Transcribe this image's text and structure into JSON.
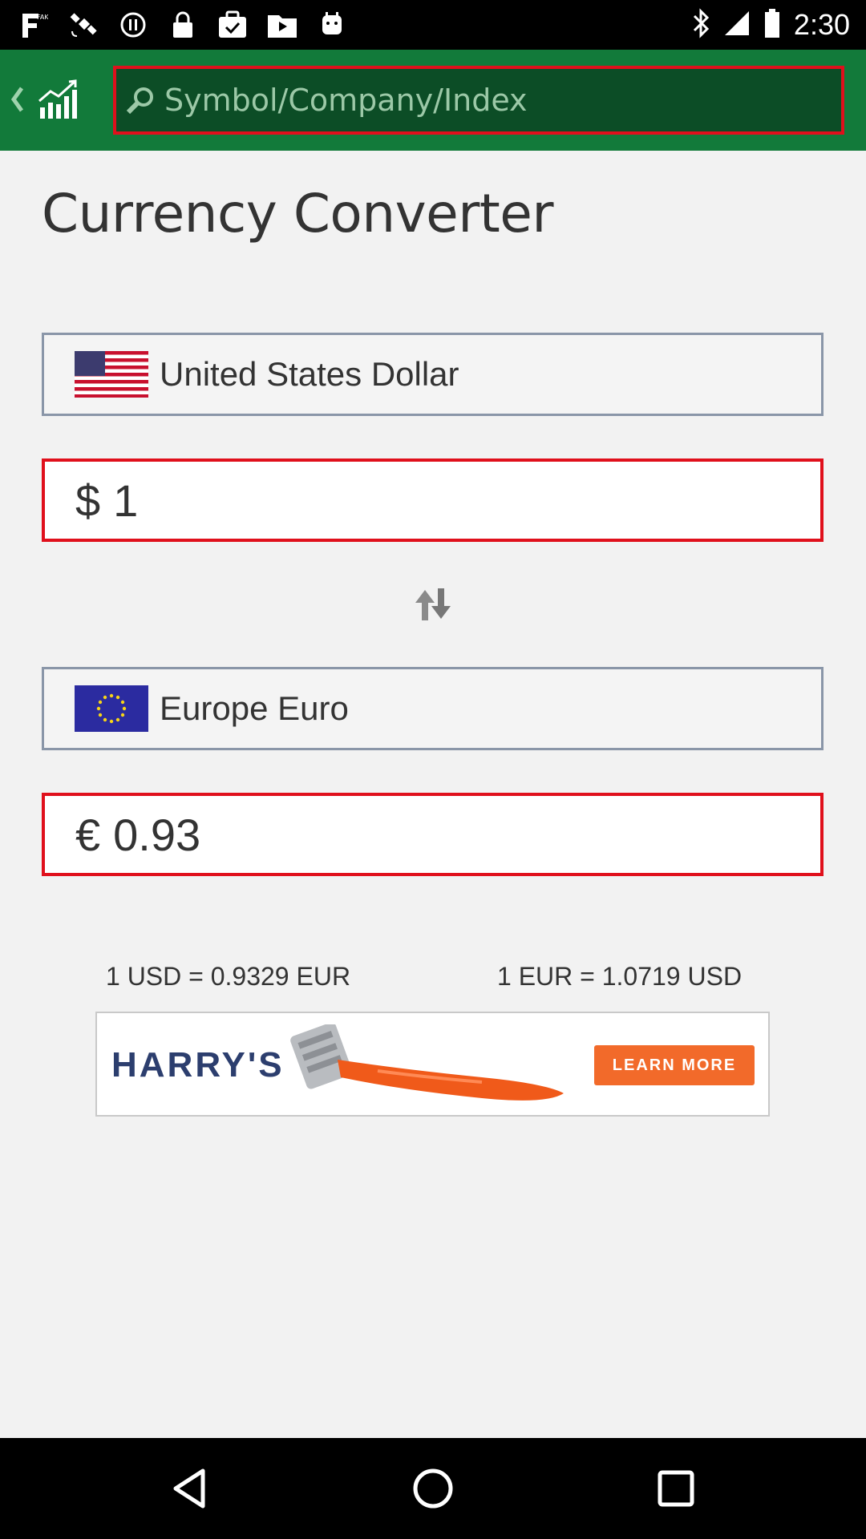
{
  "status_bar": {
    "time": "2:30",
    "left_icons": [
      "fake-gps-icon",
      "satellite-icon",
      "alert-icon",
      "lock-icon",
      "task-icon",
      "play-icon",
      "android-icon"
    ],
    "right_icons": [
      "bluetooth-icon",
      "signal-icon",
      "battery-icon"
    ]
  },
  "app_bar": {
    "search_placeholder": "Symbol/Company/Index",
    "accent": "#127a3a",
    "search_border": "#e0101c"
  },
  "page": {
    "title": "Currency Converter"
  },
  "from_currency": {
    "name": "United States Dollar",
    "symbol": "$",
    "amount": "1"
  },
  "to_currency": {
    "name": "Europe Euro",
    "symbol": "€",
    "amount": "0.93"
  },
  "rates": {
    "forward": "1 USD = 0.9329 EUR",
    "reverse": "1 EUR = 1.0719 USD"
  },
  "ad": {
    "brand": "HARRY'S",
    "cta": "LEARN MORE"
  },
  "nav_bar": {
    "buttons": [
      "back-icon",
      "home-icon",
      "recents-icon"
    ]
  }
}
